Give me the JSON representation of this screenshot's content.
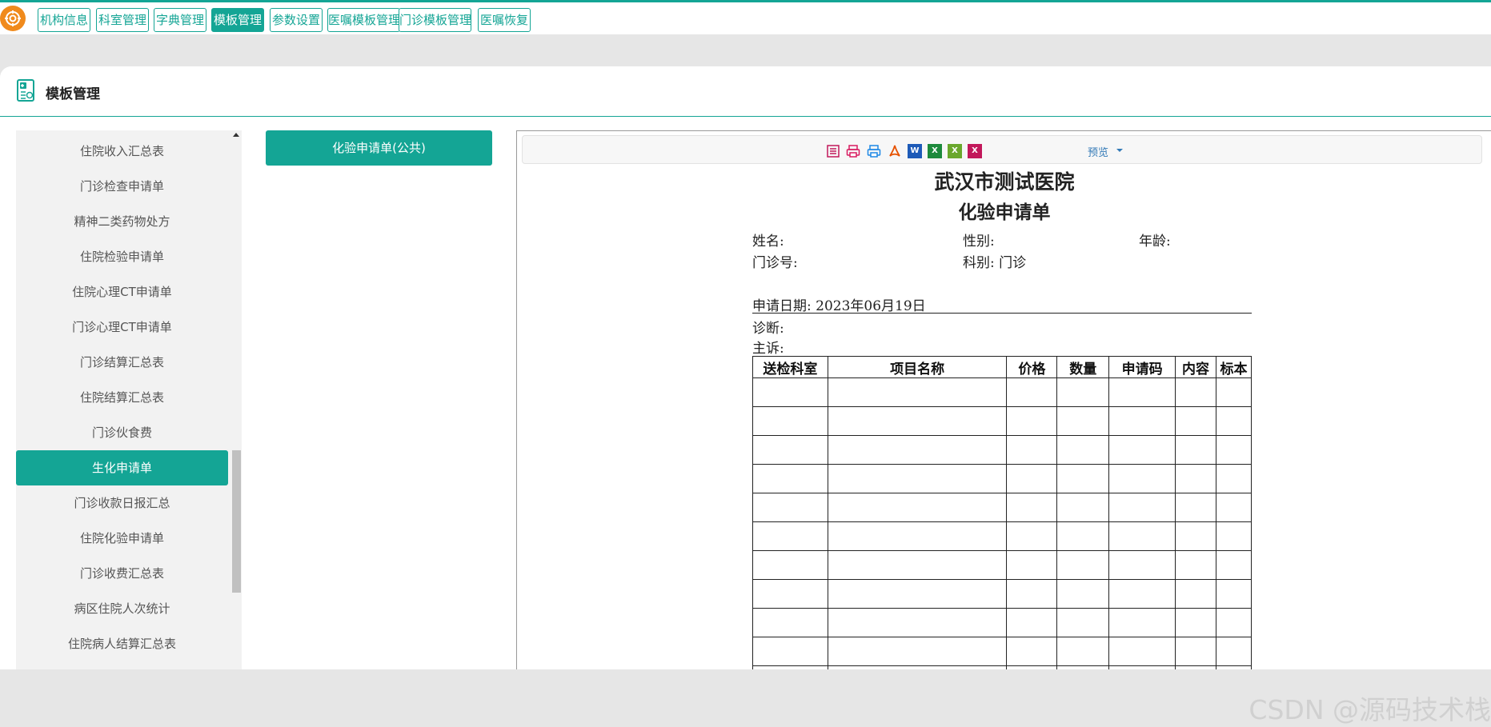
{
  "nav": {
    "items": [
      "机构信息",
      "科室管理",
      "字典管理",
      "模板管理",
      "参数设置",
      "医嘱模板管理",
      "门诊模板管理",
      "医嘱恢复"
    ],
    "active": "模板管理"
  },
  "page": {
    "title": "模板管理"
  },
  "sidebar": {
    "items": [
      "住院收入汇总表",
      "门诊检查申请单",
      "精神二类药物处方",
      "住院检验申请单",
      "住院心理CT申请单",
      "门诊心理CT申请单",
      "门诊结算汇总表",
      "住院结算汇总表",
      "门诊伙食费",
      "生化申请单",
      "门诊收款日报汇总",
      "住院化验申请单",
      "门诊收费汇总表",
      "病区住院人次统计",
      "住院病人结算汇总表"
    ],
    "active": "生化申请单"
  },
  "template_list": {
    "selected": "化验申请单(公共)"
  },
  "preview": {
    "toolbar": {
      "icons": [
        "print-icon",
        "print-color-icon",
        "print-settings-icon",
        "pdf-icon",
        "word-icon",
        "excel-icon",
        "excel-alt-icon",
        "onenote-icon"
      ],
      "preview_label": "预览"
    },
    "document": {
      "hospital_name": "武汉市测试医院",
      "form_title": "化验申请单",
      "fields": {
        "name": "姓名:",
        "gender": "性别:",
        "age": "年龄:",
        "outpatient_no": "门诊号:",
        "department": "科别: 门诊",
        "apply_date": "申请日期: 2023年06月19日",
        "diagnosis": "诊断:",
        "chief_complaint": "主诉:"
      },
      "table": {
        "headers": [
          "送检科室",
          "项目名称",
          "价格",
          "数量",
          "申请码",
          "内容",
          "标本"
        ],
        "row_count": 11
      }
    }
  },
  "watermark": "CSDN @源码技术栈",
  "colors": {
    "accent": "#14a595",
    "logo": "#f08a1c"
  }
}
